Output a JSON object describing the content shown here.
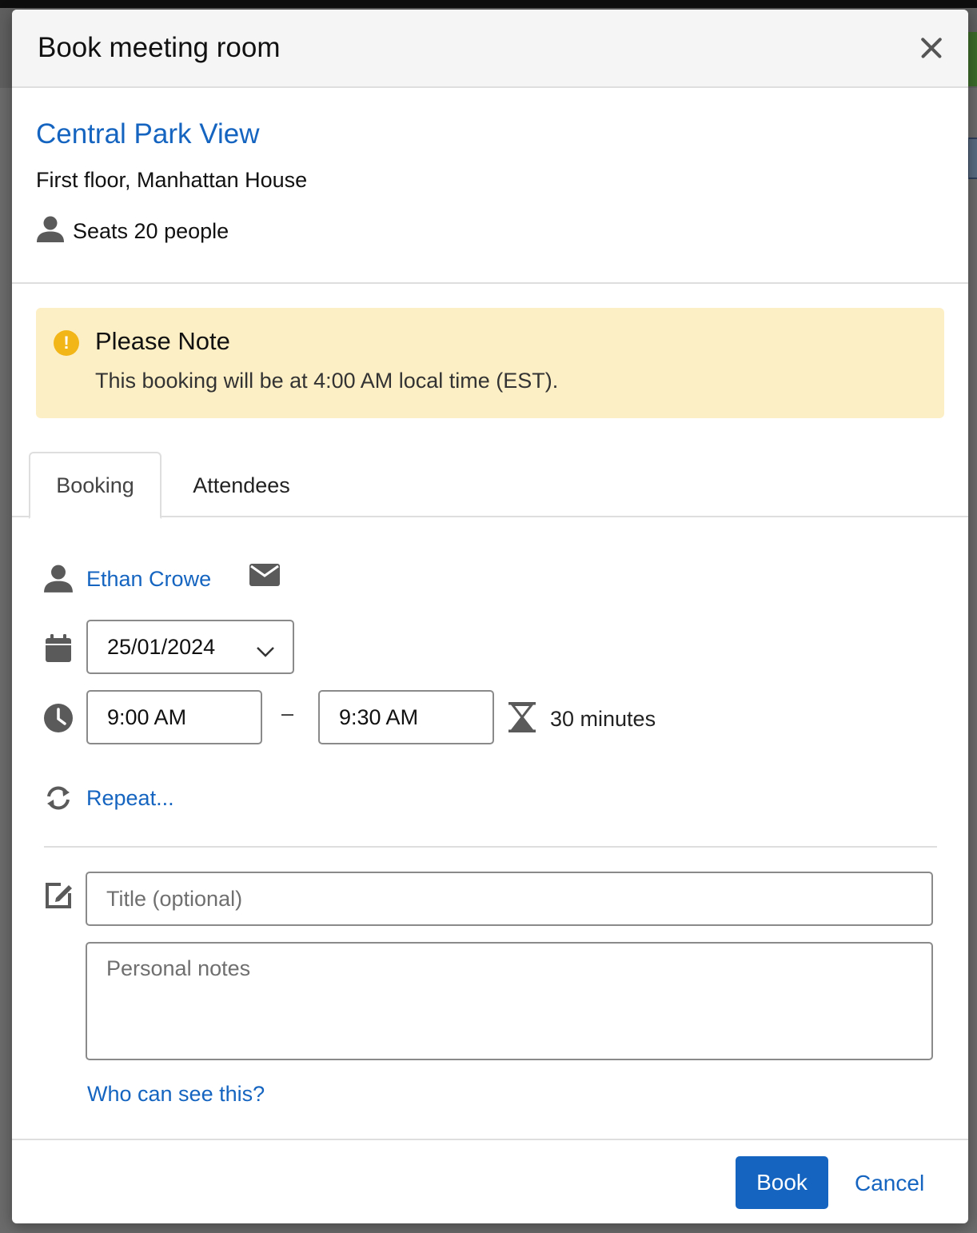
{
  "dialog": {
    "title": "Book meeting room"
  },
  "room": {
    "name": "Central Park View",
    "location": "First floor, Manhattan House",
    "seats": "Seats 20 people"
  },
  "note": {
    "title": "Please Note",
    "text": "This booking will be at 4:00 AM local time (EST).",
    "icon": "!"
  },
  "tabs": [
    {
      "label": "Booking",
      "active": true
    },
    {
      "label": "Attendees",
      "active": false
    }
  ],
  "booking": {
    "organizer": "Ethan Crowe",
    "date": "25/01/2024",
    "start_time": "9:00 AM",
    "separator": "–",
    "end_time": "9:30 AM",
    "duration": "30 minutes",
    "repeat_label": "Repeat...",
    "title_placeholder": "Title (optional)",
    "notes_placeholder": "Personal notes",
    "visibility_link": "Who can see this?"
  },
  "footer": {
    "book_label": "Book",
    "cancel_label": "Cancel"
  },
  "colors": {
    "accent": "#1565c0",
    "note_background": "#fdefc5",
    "note_icon": "#f2b619",
    "icon_gray": "#5a5a5a"
  },
  "icons": {
    "close": "close-icon",
    "seats": "person-icon",
    "note": "warning-icon",
    "organizer": "person-icon",
    "email": "envelope-icon",
    "date": "calendar-icon",
    "date_dropdown": "chevron-down-icon",
    "time": "clock-icon",
    "duration": "hourglass-icon",
    "repeat": "refresh-icon",
    "title": "edit-icon"
  }
}
